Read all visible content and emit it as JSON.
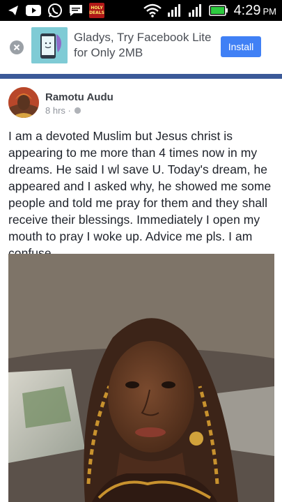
{
  "status_bar": {
    "time": "4:29",
    "ampm": "PM",
    "icons": [
      "telegram-icon",
      "youtube-icon",
      "whatsapp-icon",
      "messages-icon",
      "news-app-icon",
      "wifi-icon",
      "signal-icon",
      "signal-icon",
      "battery-icon"
    ],
    "news_badge_text": "HOLY DEALS"
  },
  "ad": {
    "headline": "Gladys, Try Facebook Lite for Only 2MB",
    "install_label": "Install",
    "accent": "#4080f5"
  },
  "post": {
    "author": "Ramotu Audu",
    "time": "8 hrs ·",
    "text": "I am a devoted Muslim but Jesus christ is appearing to me more than 4 times now in my dreams. He said I wl save U. Today's dream, he appeared and I asked why, he showed me some people and told me pray for them and they shall receive their blessings. Immediately I open my mouth to pray I woke up. Advice me pls. I am confuse."
  },
  "colors": {
    "facebook_blue": "#3b5998",
    "text": "#1d2129",
    "meta": "#90949c"
  }
}
